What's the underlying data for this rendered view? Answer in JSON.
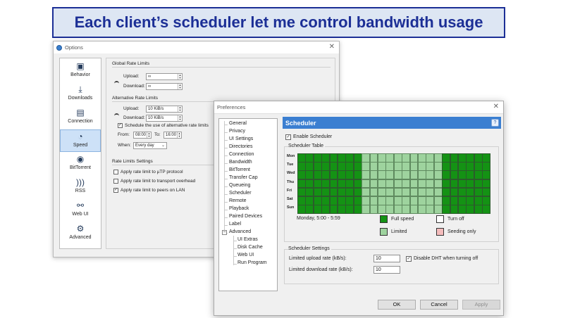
{
  "banner": {
    "text": "Each client’s scheduler let me control bandwidth usage"
  },
  "options_window": {
    "title": "Options",
    "sidebar": [
      {
        "label": "Behavior",
        "icon": "behavior-icon"
      },
      {
        "label": "Downloads",
        "icon": "download-icon"
      },
      {
        "label": "Connection",
        "icon": "connection-icon"
      },
      {
        "label": "Speed",
        "icon": "speed-icon",
        "selected": true
      },
      {
        "label": "BitTorrent",
        "icon": "bittorrent-icon"
      },
      {
        "label": "RSS",
        "icon": "rss-icon"
      },
      {
        "label": "Web UI",
        "icon": "webui-icon"
      },
      {
        "label": "Advanced",
        "icon": "gears-icon"
      }
    ],
    "global_limits": {
      "title": "Global Rate Limits",
      "upload_label": "Upload:",
      "upload_value": "∞",
      "download_label": "Download:",
      "download_value": "∞"
    },
    "alt_limits": {
      "title": "Alternative Rate Limits",
      "upload_label": "Upload:",
      "upload_value": "10 KiB/s",
      "download_label": "Download:",
      "download_value": "10 KiB/s",
      "schedule_label": "Schedule the use of alternative rate limits",
      "from_label": "From:",
      "from_value": "08:00",
      "to_label": "To:",
      "to_value": "16:00",
      "when_label": "When:",
      "when_value": "Every day"
    },
    "rate_settings": {
      "title": "Rate Limits Settings",
      "utp_label": "Apply rate limit to µTP protocol",
      "overhead_label": "Apply rate limit to transport overhead",
      "lan_label": "Apply rate limit to peers on LAN"
    }
  },
  "prefs_window": {
    "title": "Preferences",
    "tree": [
      "General",
      "Privacy",
      "UI Settings",
      "Directories",
      "Connection",
      "Bandwidth",
      "BitTorrent",
      "Transfer Cap",
      "Queueing",
      "Scheduler",
      "Remote",
      "Playback",
      "Paired Devices",
      "Label",
      "Advanced",
      "UI Extras",
      "Disk Cache",
      "Web UI",
      "Run Program"
    ],
    "header": "Scheduler",
    "help": "?",
    "enable_label": "Enable Scheduler",
    "table_title": "Scheduler Table",
    "days": [
      "Mon",
      "Tue",
      "Wed",
      "Thu",
      "Fri",
      "Sat",
      "Sun"
    ],
    "hover_text": "Monday, 5:00 - 5:59",
    "legend": {
      "full": "Full speed",
      "off": "Turn off",
      "limited": "Limited",
      "seeding": "Seeding only"
    },
    "colors": {
      "full": "#149214",
      "limited": "#9ed39e",
      "off": "#ffffff",
      "seeding": "#f4bcbc"
    },
    "schedule": {
      "limited_hours_start": 8,
      "limited_hours_end": 18,
      "hours": 24
    },
    "settings_title": "Scheduler Settings",
    "upload_label": "Limited upload rate (kB/s):",
    "upload_value": "10",
    "download_label": "Limited download rate (kB/s):",
    "download_value": "10",
    "dht_label": "Disable DHT when turning off",
    "buttons": {
      "ok": "OK",
      "cancel": "Cancel",
      "apply": "Apply"
    }
  }
}
